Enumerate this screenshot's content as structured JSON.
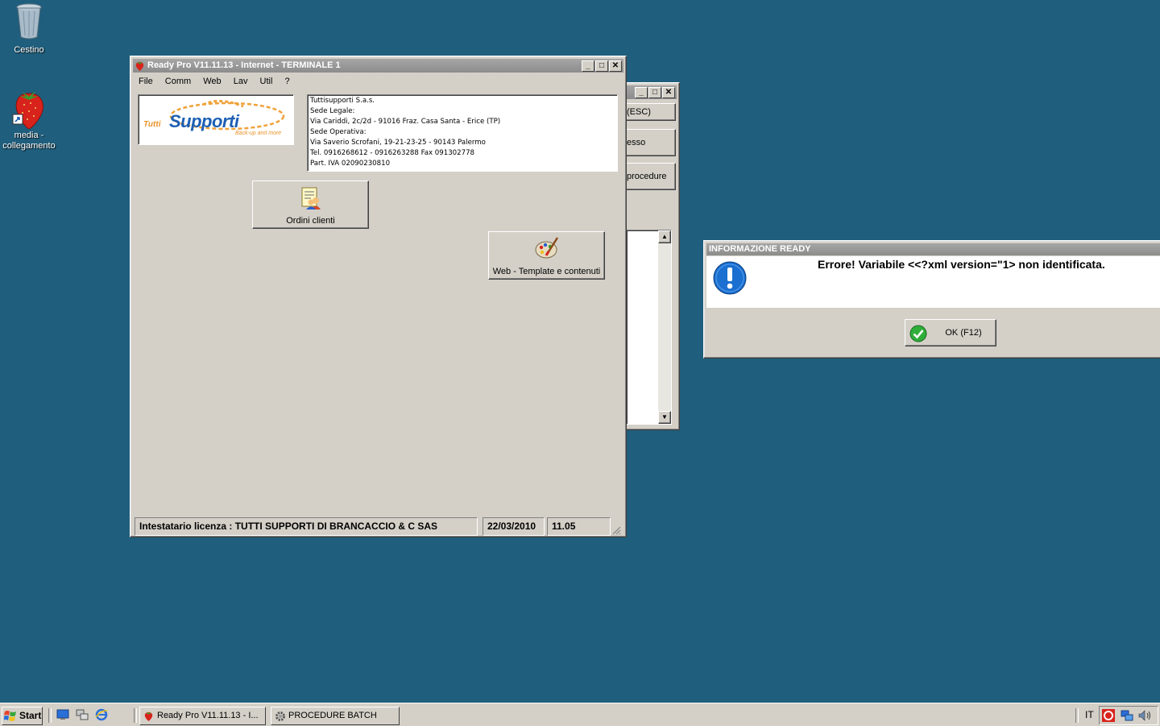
{
  "desktop": {
    "icons": [
      {
        "label": "Cestino",
        "icon": "recycle-bin-icon"
      },
      {
        "label": "media -\ncollegamento",
        "icon": "strawberry-shortcut-icon"
      }
    ]
  },
  "main_window": {
    "title": "Ready Pro V11.11.13 - Internet - TERMINALE 1",
    "menu": [
      "File",
      "Comm",
      "Web",
      "Lav",
      "Util",
      "?"
    ],
    "logo_text": "Supporti",
    "logo_prefix": "Tutti",
    "logo_tagline": "Back-up and more",
    "company_info": [
      "Tuttisupporti S.a.s.",
      "Sede Legale:",
      "Via Cariddi, 2c/2d - 91016 Fraz. Casa Santa - Erice (TP)",
      "Sede Operativa:",
      "Via Saverio Scrofani, 19-21-23-25 - 90143 Palermo",
      "Tel. 0916268612 - 0916263288 Fax 091302778",
      "Part. IVA 02090230810"
    ],
    "buttons": {
      "orders": "Ordini clienti",
      "web": "Web - Template e contenuti"
    },
    "status": {
      "license": "Intestatario licenza : TUTTI SUPPORTI DI BRANCACCIO & C SAS",
      "date": "22/03/2010",
      "time": "11.05"
    }
  },
  "back_window": {
    "buttons": [
      "(ESC)",
      "esso",
      "procedure"
    ]
  },
  "dialog": {
    "title": "INFORMAZIONE READY",
    "message": "Errore! Variabile <<?xml version=\"1> non identificata.",
    "ok_label": "OK (F12)"
  },
  "taskbar": {
    "start_label": "Start",
    "tasks": [
      "Ready Pro V11.11.13 - I...",
      "PROCEDURE BATCH"
    ],
    "language": "IT"
  },
  "colors": {
    "desktop": "#1f5e7c",
    "window_face": "#d4d0c8",
    "inactive_title": "#8c8c8c",
    "info_icon": "#1a6fd0"
  }
}
